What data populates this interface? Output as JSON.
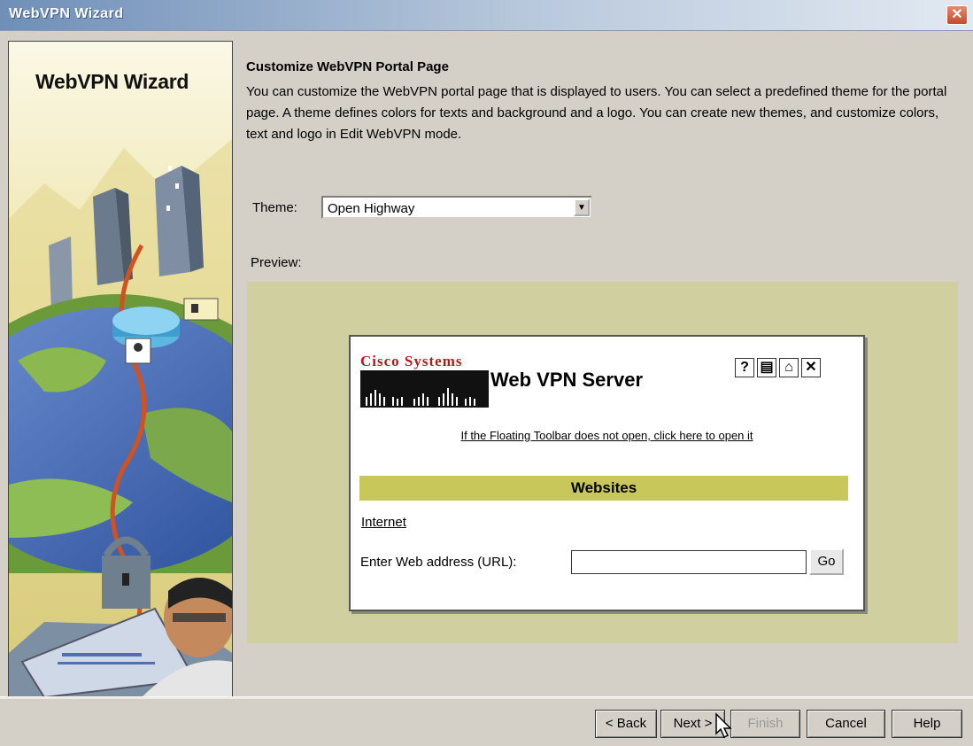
{
  "window": {
    "title": "WebVPN Wizard",
    "close_symbol": "✕"
  },
  "sidebar": {
    "title": "WebVPN Wizard"
  },
  "content": {
    "title": "Customize WebVPN Portal Page",
    "description": "You can customize the WebVPN portal page that is displayed to users. You can select a predefined theme for the portal page. A theme defines colors for texts and background and a logo. You can create new themes, and customize colors, text and logo in Edit WebVPN mode.",
    "theme_label": "Theme:",
    "theme_value": "Open Highway",
    "preview_label": "Preview:"
  },
  "preview": {
    "brand": "Cisco Systems",
    "server_title": "Web VPN Server",
    "toolbar_icons": [
      "?",
      "▤",
      "⌂",
      "✕"
    ],
    "floating_toolbar_link": "If the Floating Toolbar does not open, click here to open it",
    "websites_heading": "Websites",
    "internet_link": "Internet",
    "url_label": "Enter Web address (URL):",
    "url_value": "",
    "go_label": "Go",
    "background_color": "#cfcfa0",
    "heading_color": "#c8c85a"
  },
  "buttons": {
    "back": "< Back",
    "next": "Next >",
    "finish": "Finish",
    "cancel": "Cancel",
    "help": "Help"
  }
}
